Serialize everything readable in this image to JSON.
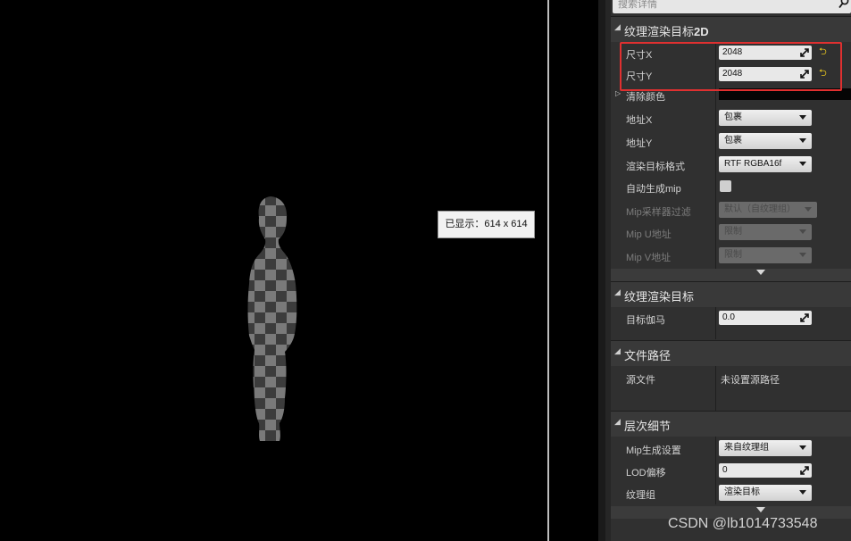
{
  "viewport": {
    "displayed_label": "已显示：614 x 614"
  },
  "details": {
    "search_placeholder": "搜索详情",
    "sections": {
      "render_target_2d": {
        "title_prefix": "纹理渲染目标",
        "title_bold": "2D"
      },
      "render_target": {
        "title": "纹理渲染目标"
      },
      "file_path": {
        "title": "文件路径"
      },
      "level_of_detail": {
        "title": "层次细节"
      }
    },
    "size_x": {
      "label": "尺寸X",
      "value": "2048"
    },
    "size_y": {
      "label": "尺寸Y",
      "value": "2048"
    },
    "clear_color": {
      "label": "清除颜色",
      "color": "#050505"
    },
    "address_x": {
      "label": "地址X",
      "value": "包裹"
    },
    "address_y": {
      "label": "地址Y",
      "value": "包裹"
    },
    "render_target_format": {
      "label": "渲染目标格式",
      "value": "RTF RGBA16f"
    },
    "auto_mip": {
      "label": "自动生成mip",
      "checked": false
    },
    "mip_sampler_filter": {
      "label": "Mip采样器过滤",
      "value": "默认（自纹理组）"
    },
    "mip_u_address": {
      "label": "Mip U地址",
      "value": "限制"
    },
    "mip_v_address": {
      "label": "Mip V地址",
      "value": "限制"
    },
    "target_gamma": {
      "label": "目标伽马",
      "value": "0.0"
    },
    "source_file": {
      "label": "源文件",
      "value": "未设置源路径"
    },
    "mip_gen_settings": {
      "label": "Mip生成设置",
      "value": "来自纹理组"
    },
    "lod_bias": {
      "label": "LOD偏移",
      "value": "0"
    },
    "texture_group": {
      "label": "纹理组",
      "value": "渲染目标"
    }
  },
  "watermark": "CSDN @lb1014733548",
  "colors": {
    "highlight": "#e03030",
    "reset_arrow": "#e0c020",
    "panel_bg": "#303030",
    "section_bg": "#393939"
  }
}
